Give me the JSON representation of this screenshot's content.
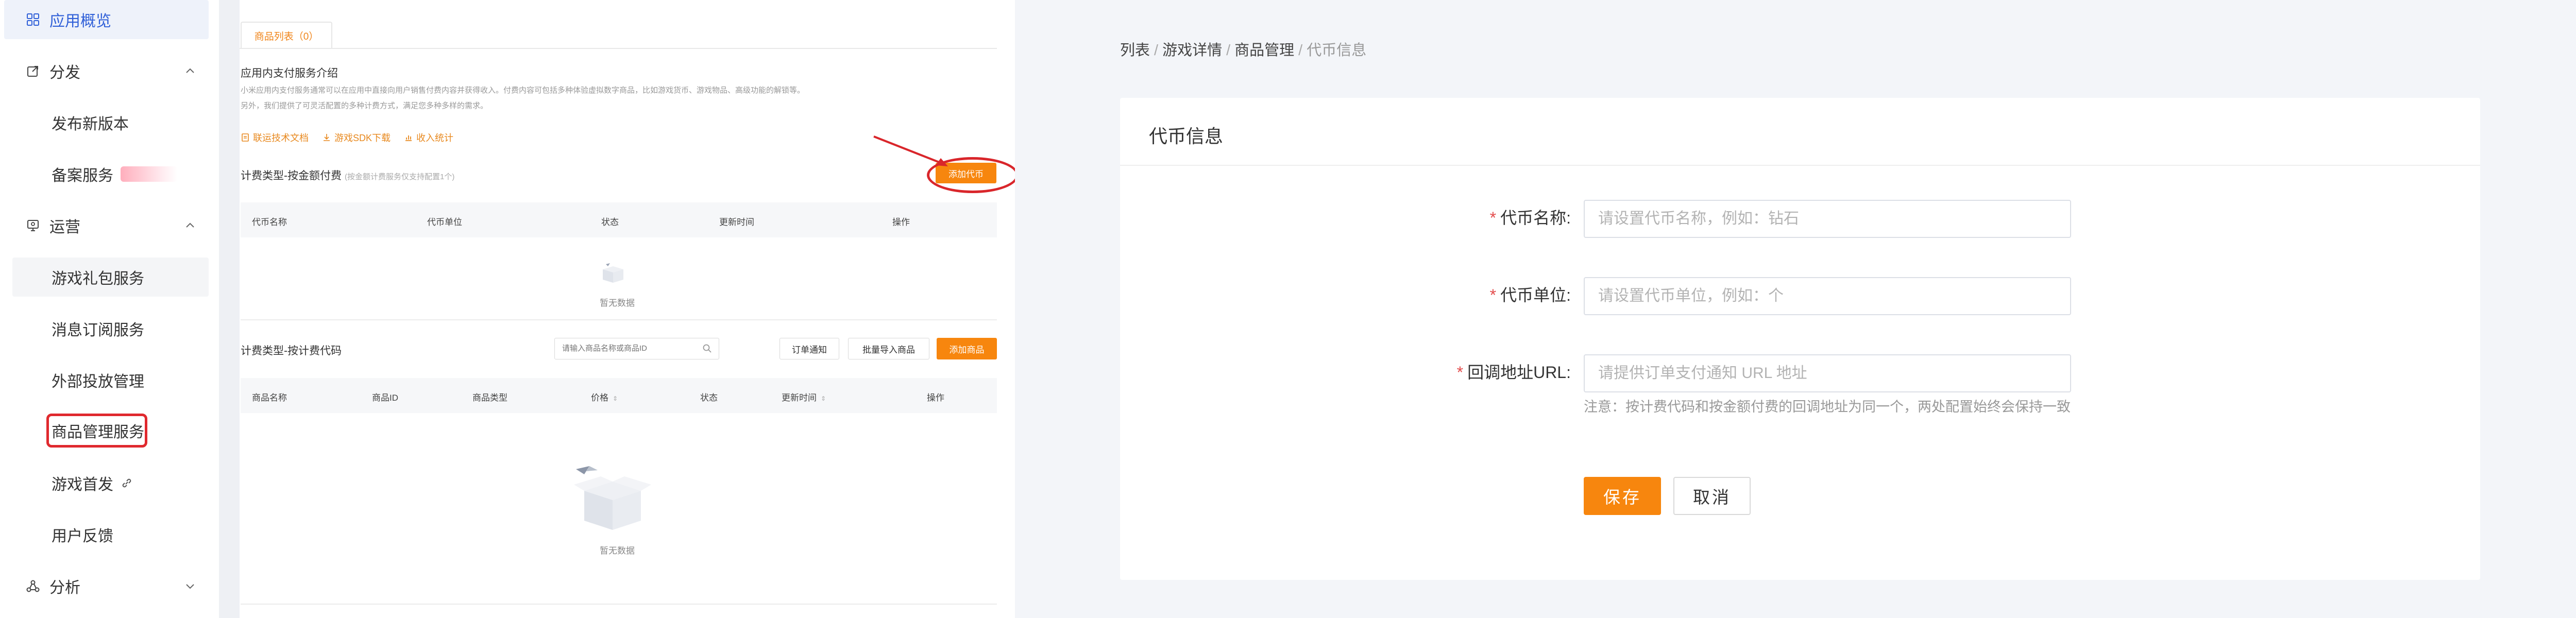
{
  "sidebar": {
    "overview": "应用概览",
    "distribute": {
      "label": "分发",
      "items": [
        "发布新版本",
        "备案服务"
      ]
    },
    "operate": {
      "label": "运营",
      "items": [
        "游戏礼包服务",
        "消息订阅服务",
        "外部投放管理",
        "商品管理服务",
        "游戏首发",
        "用户反馈"
      ]
    },
    "analysis": {
      "label": "分析"
    }
  },
  "middle": {
    "tab_label": "商品列表（0）",
    "intro_title": "应用内支付服务介绍",
    "intro_desc_1": "小米应用内支付服务通常可以在应用中直接向用户销售付费内容并获得收入。付费内容可包括多种体验虚拟数字商品，比如游戏货币、游戏物品、高级功能的解锁等。",
    "intro_desc_2": "另外，我们提供了可灵活配置的多种计费方式，满足您多种多样的需求。",
    "links": [
      "联运技术文档",
      "游戏SDK下载",
      "收入统计"
    ],
    "section1": {
      "title": "计费类型-按金额付费",
      "hint": "(按金额计费服务仅支持配置1个)",
      "add_button": "添加代币",
      "columns": [
        "代币名称",
        "代币单位",
        "状态",
        "更新时间",
        "操作"
      ],
      "empty": "暂无数据"
    },
    "section2": {
      "title": "计费类型-按计费代码",
      "search_placeholder": "请输入商品名称或商品ID",
      "buttons": [
        "订单通知",
        "批量导入商品",
        "添加商品"
      ],
      "columns": [
        "商品名称",
        "商品ID",
        "商品类型",
        "价格",
        "状态",
        "更新时间",
        "操作"
      ],
      "empty": "暂无数据"
    }
  },
  "right": {
    "breadcrumb": [
      "列表",
      "游戏详情",
      "商品管理",
      "代币信息"
    ],
    "card_title": "代币信息",
    "fields": [
      {
        "label": "代币名称:",
        "placeholder": "请设置代币名称，例如：钻石"
      },
      {
        "label": "代币单位:",
        "placeholder": "请设置代币单位，例如：个"
      },
      {
        "label": "回调地址URL:",
        "placeholder": "请提供订单支付通知 URL 地址"
      }
    ],
    "note": "注意：按计费代码和按金额付费的回调地址为同一个，两处配置始终会保持一致",
    "save_button": "保存",
    "cancel_button": "取消"
  },
  "colors": {
    "accent": "#f7860e",
    "annotation_red": "#d9262b",
    "nav_active": "#3060d8"
  }
}
